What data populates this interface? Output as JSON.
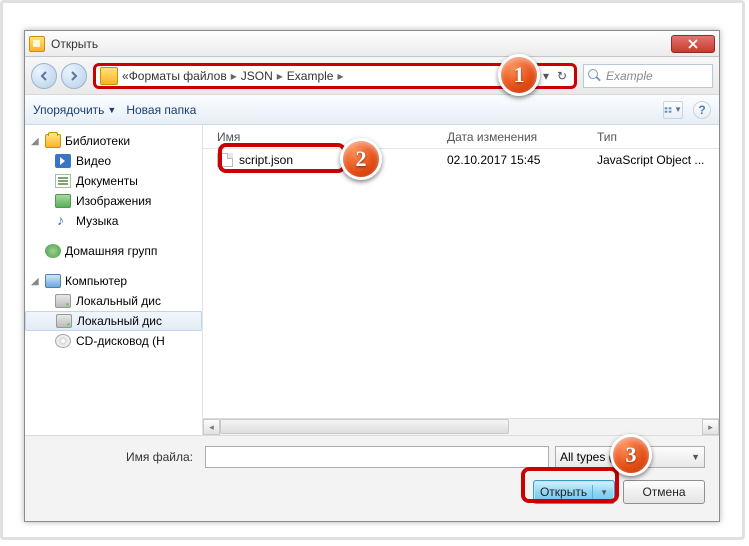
{
  "window": {
    "title": "Открыть"
  },
  "address": {
    "prefix": "«",
    "crumbs": [
      "Форматы файлов",
      "JSON",
      "Example"
    ]
  },
  "search": {
    "placeholder": "Example"
  },
  "toolbar": {
    "organize": "Упорядочить",
    "new_folder": "Новая папка"
  },
  "sidebar": {
    "libraries": {
      "label": "Библиотеки",
      "items": [
        "Видео",
        "Документы",
        "Изображения",
        "Музыка"
      ]
    },
    "homegroup": {
      "label": "Домашняя групп"
    },
    "computer": {
      "label": "Компьютер",
      "items": [
        "Локальный дис",
        "Локальный дис",
        "CD-дисковод (Н"
      ]
    }
  },
  "columns": {
    "name": "Имя",
    "date": "Дата изменения",
    "type": "Тип"
  },
  "files": [
    {
      "name": "script.json",
      "date": "02.10.2017 15:45",
      "type": "JavaScript Object ..."
    }
  ],
  "filename": {
    "label": "Имя файла:",
    "value": ""
  },
  "filetype": {
    "selected": "All types (*.*)"
  },
  "buttons": {
    "open": "Открыть",
    "cancel": "Отмена"
  },
  "badges": {
    "b1": "1",
    "b2": "2",
    "b3": "3"
  }
}
